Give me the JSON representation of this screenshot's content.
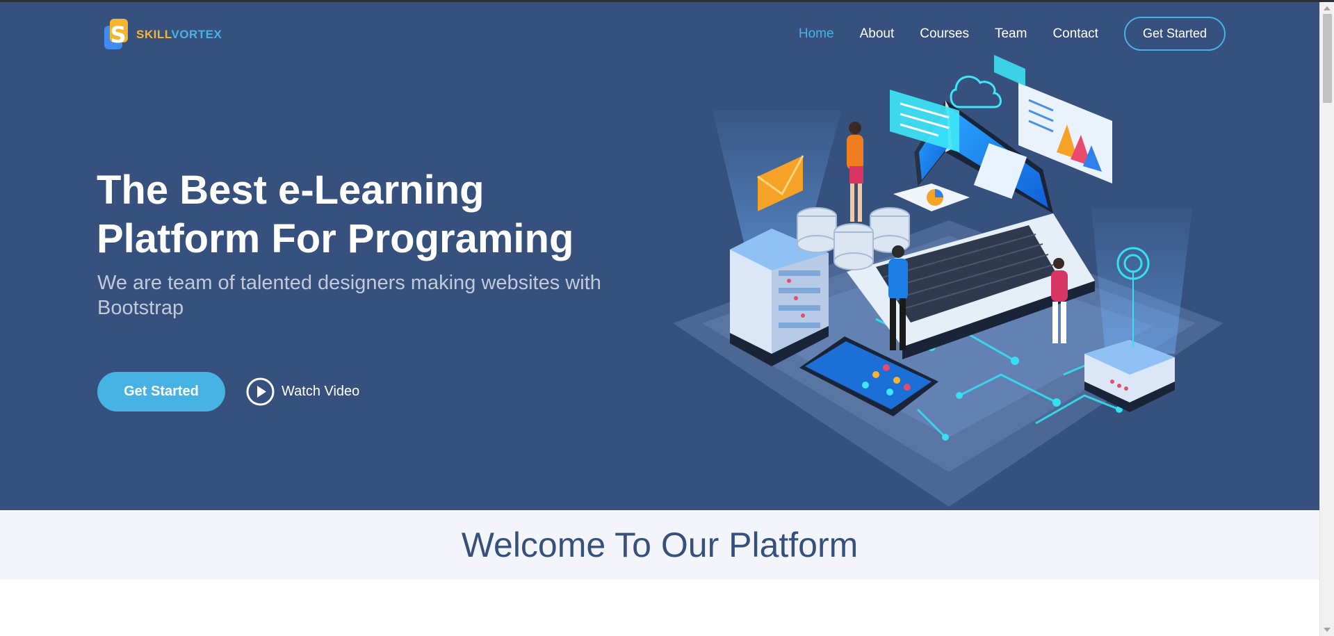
{
  "brand": {
    "part1": "SKILL",
    "part2": "VORTEX",
    "mark": "S"
  },
  "nav": {
    "items": [
      {
        "label": "Home",
        "active": true
      },
      {
        "label": "About",
        "active": false
      },
      {
        "label": "Courses",
        "active": false
      },
      {
        "label": "Team",
        "active": false
      },
      {
        "label": "Contact",
        "active": false
      }
    ],
    "cta": "Get Started"
  },
  "hero": {
    "title_line1": "The Best e-Learning",
    "title_line2": "Platform For Programing",
    "subtitle": "We are team of talented designers making websites with Bootstrap",
    "primary_button": "Get Started",
    "video_link": "Watch Video"
  },
  "welcome": {
    "title": "Welcome To Our Platform"
  },
  "colors": {
    "hero_bg": "#37517e",
    "accent": "#47b2e4",
    "brand_orange": "#f6b52f",
    "band_bg": "#f3f5fa"
  },
  "icons": {
    "play": "play-circle-icon",
    "brand": "skillvortex-logo-icon"
  }
}
